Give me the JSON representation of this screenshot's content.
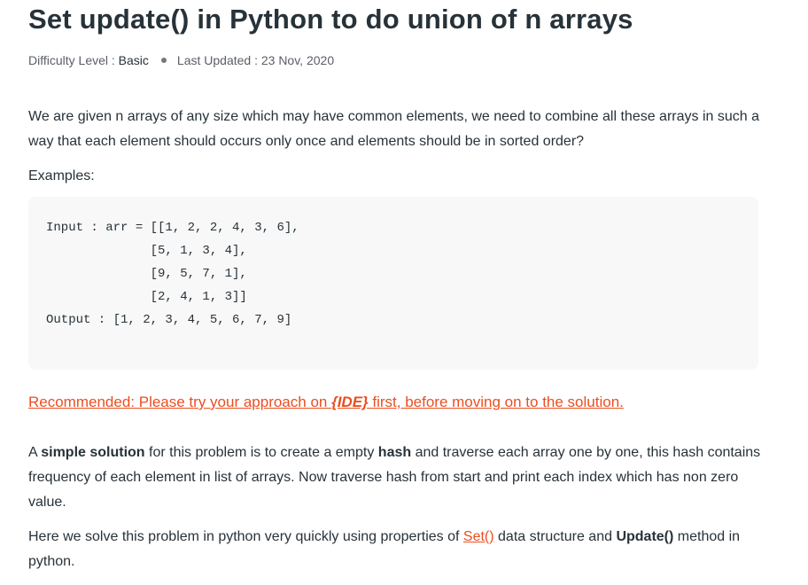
{
  "article": {
    "title": "Set update() in Python to do union of n arrays",
    "difficulty_label": "Difficulty Level : ",
    "difficulty_value": "Basic",
    "updated_label": "Last Updated : 23 Nov, 2020",
    "intro": "We are given n arrays of any size which may have common elements, we need to combine all these arrays in such a way that each element should occurs only once and elements should be in sorted order?",
    "examples_label": "Examples:",
    "code": "Input : arr = [[1, 2, 2, 4, 3, 6],\n              [5, 1, 3, 4],\n              [9, 5, 7, 1],\n              [2, 4, 1, 3]]\nOutput : [1, 2, 3, 4, 5, 6, 7, 9]",
    "recommended": {
      "before": "Recommended: Please try your approach on ",
      "ide": "{IDE}",
      "after": " first, before moving on to the solution."
    },
    "para1": {
      "t1": "A ",
      "b1": "simple solution",
      "t2": " for this problem is to create a empty ",
      "b2": "hash",
      "t3": " and traverse each array one by one, this hash contains frequency of each element in list of arrays. Now traverse hash from start and print each index which has non zero value."
    },
    "para2": {
      "t1": "Here we solve this problem in python very quickly using properties of ",
      "link": "Set()",
      "t2": " data structure and ",
      "b1": "Update()",
      "t3": " method in python."
    },
    "colors": {
      "link": "#ec4e20",
      "text": "#273239",
      "code_bg": "#f8f8f8"
    }
  }
}
